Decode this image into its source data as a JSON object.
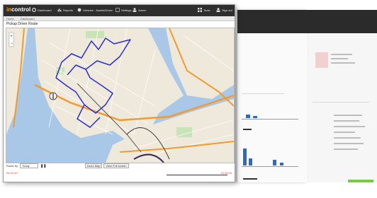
{
  "back_windows": {
    "accent_blue": "#2f6cb5",
    "accent_green": "#7ac943",
    "header_dark": "#2b2b2b"
  },
  "app": {
    "logo_prefix": "in",
    "logo_main": "control",
    "nav": [
      "Dashboard",
      "Reports",
      "Vehicles · Assets/Driver",
      "Settings",
      "Admin"
    ],
    "nav_right": [
      "Tools",
      "Sign out"
    ],
    "breadcrumb": [
      "Home",
      "Dashboard"
    ]
  },
  "page": {
    "title": "Pickup Driver Route"
  },
  "controls": {
    "label": "Route by",
    "select_value": "Today",
    "zoom_button": "Zoom Map",
    "fullscreen_button": "View Full screen"
  },
  "timeline": {
    "start": "06:22:00",
    "end": "16:48:00"
  },
  "colors": {
    "route": "#2a2ed0",
    "highway": "#f39a2f",
    "water": "#a9c8e8",
    "land": "#efe9dc",
    "park": "#c8e3b5"
  }
}
